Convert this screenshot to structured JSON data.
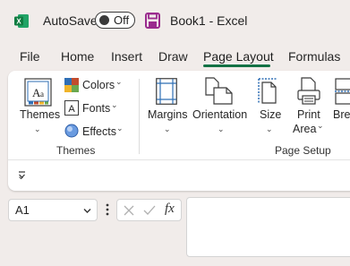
{
  "titlebar": {
    "autosave_label": "AutoSave",
    "autosave_state": "Off",
    "document_title": "Book1  -  Excel",
    "brand_color": "#107c41"
  },
  "tabs": [
    {
      "label": "File"
    },
    {
      "label": "Home"
    },
    {
      "label": "Insert"
    },
    {
      "label": "Draw"
    },
    {
      "label": "Page Layout",
      "active": true
    },
    {
      "label": "Formulas"
    }
  ],
  "ribbon": {
    "themes_group": {
      "title": "Themes",
      "themes_label": "Themes",
      "colors_label": "Colors",
      "fonts_label": "Fonts",
      "effects_label": "Effects"
    },
    "page_setup_group": {
      "title": "Page Setup",
      "margins_label": "Margins",
      "orientation_label": "Orientation",
      "size_label": "Size",
      "print_area_line1": "Print",
      "print_area_line2": "Area",
      "breaks_label": "Brea"
    }
  },
  "formula_bar": {
    "name_box_value": "A1",
    "fx_label": "fx",
    "formula_value": ""
  }
}
